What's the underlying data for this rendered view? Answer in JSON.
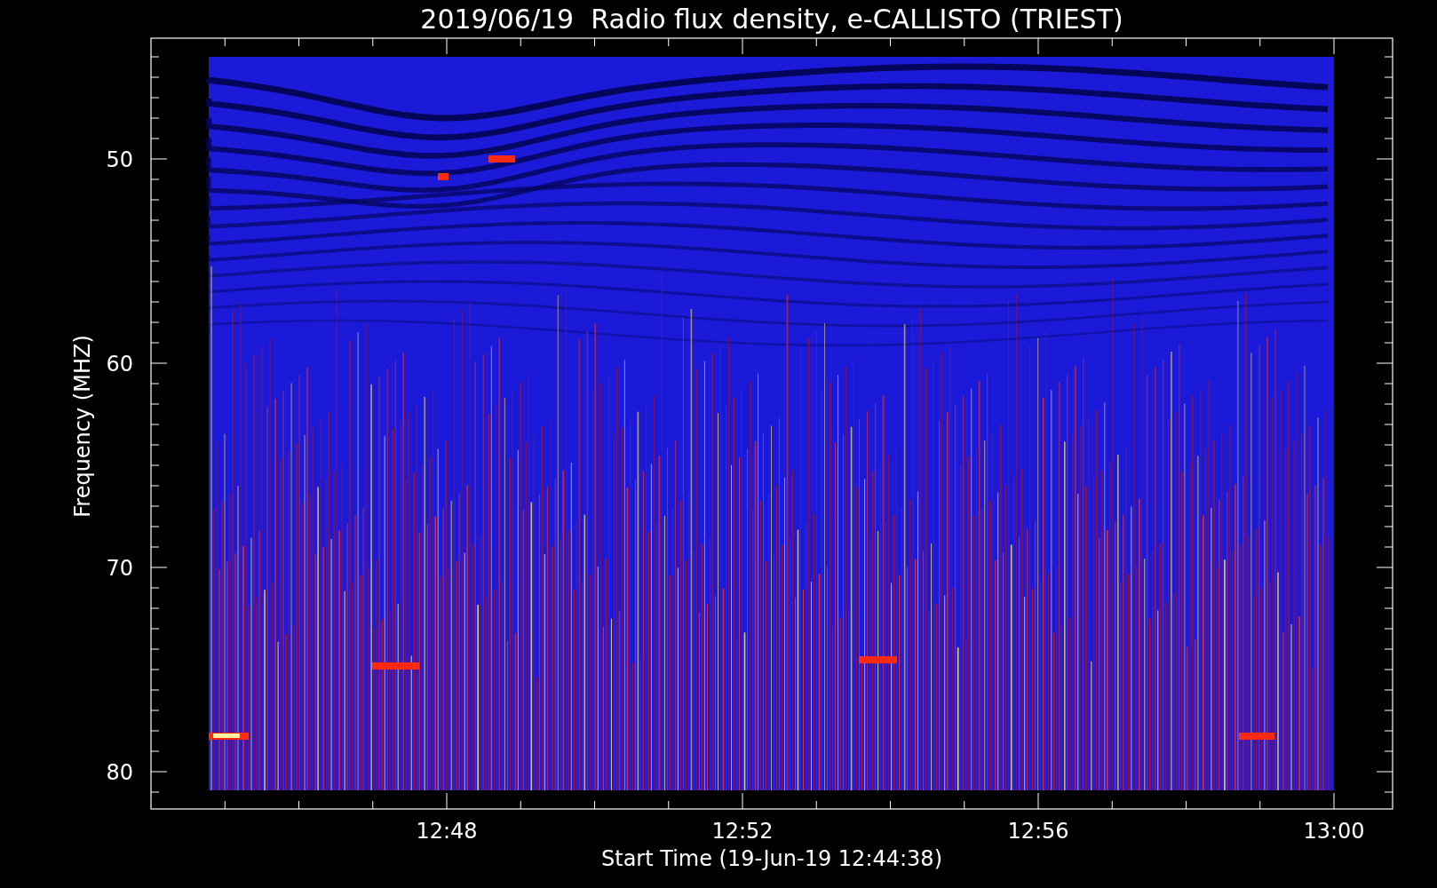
{
  "title": "2019/06/19  Radio flux density, e-CALLISTO (TRIEST)",
  "y_axis": {
    "label": "Frequency (MHZ)",
    "tick_labels": [
      "50",
      "60",
      "70",
      "80"
    ]
  },
  "x_axis": {
    "label": "Start Time (19-Jun-19 12:44:38)",
    "tick_labels": [
      "12:48",
      "12:52",
      "12:56",
      "13:00"
    ]
  }
}
